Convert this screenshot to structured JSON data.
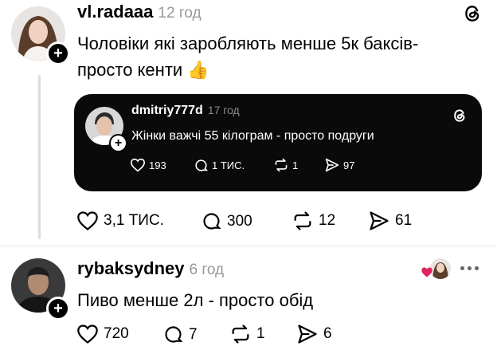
{
  "post": {
    "username": "vl.radaaa",
    "time": "12 год",
    "text_line1": "Чоловіки які заробляють менше  5к баксів-",
    "text_line2": "просто кенти",
    "emoji": "👍",
    "likes": "3,1 ТИС.",
    "comments": "300",
    "reposts": "12",
    "shares": "61"
  },
  "quoted": {
    "username": "dmitriy777d",
    "time": "17 год",
    "text": "Жінки важчі 55 кілограм - просто подруги",
    "likes": "193",
    "comments": "1 ТИС.",
    "reposts": "1",
    "shares": "97"
  },
  "reply": {
    "username": "rybaksydney",
    "time": "6 год",
    "text": "Пиво менше 2л - просто обід",
    "likes": "720",
    "comments": "7",
    "reposts": "1",
    "shares": "6"
  },
  "colors": {
    "background": "#ffffff",
    "quote_card": "#0a0a0a",
    "muted": "#999999",
    "heart_red": "#e0245e"
  }
}
